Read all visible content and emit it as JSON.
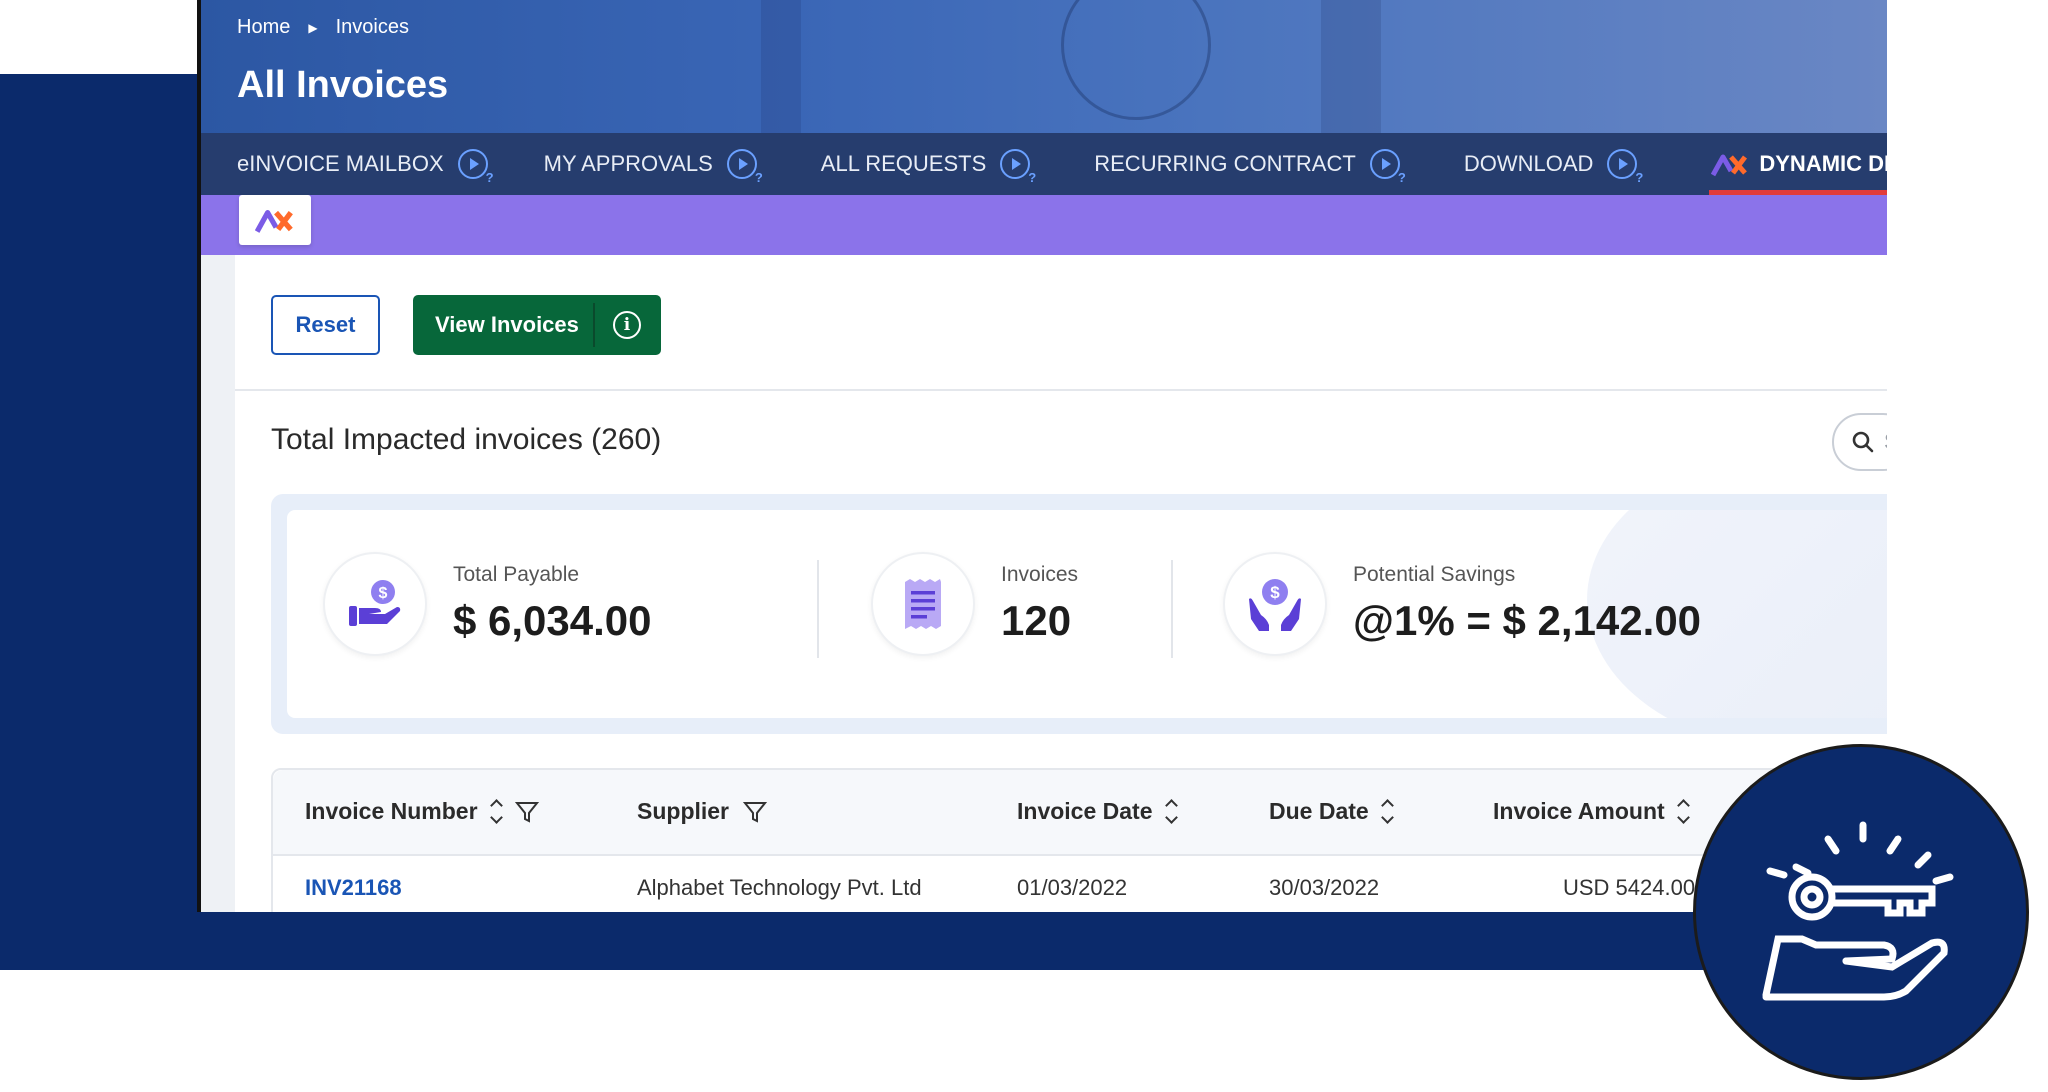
{
  "breadcrumb": {
    "home": "Home",
    "current": "Invoices"
  },
  "header": {
    "title": "All Invoices"
  },
  "tabs": [
    {
      "label": "eINVOICE MAILBOX"
    },
    {
      "label": "MY APPROVALS"
    },
    {
      "label": "ALL REQUESTS"
    },
    {
      "label": "RECURRING CONTRACT"
    },
    {
      "label": "DOWNLOAD"
    },
    {
      "label": "DYNAMIC DISC"
    }
  ],
  "actions": {
    "reset_label": "Reset",
    "view_label": "View Invoices",
    "info_glyph": "i"
  },
  "search": {
    "placeholder": "S"
  },
  "summary": {
    "title": "Total Impacted invoices (260)",
    "kpis": [
      {
        "label": "Total Payable",
        "value": "$ 6,034.00",
        "icon": "hand-dollar-icon"
      },
      {
        "label": "Invoices",
        "value": "120",
        "icon": "receipt-icon"
      },
      {
        "label": "Potential Savings",
        "value": "@1% = $ 2,142.00",
        "icon": "savings-hands-icon"
      }
    ]
  },
  "table": {
    "columns": [
      "Invoice Number",
      "Supplier",
      "Invoice Date",
      "Due Date",
      "Invoice Amount"
    ],
    "rows": [
      {
        "invoice_number": "INV21168",
        "supplier": "Alphabet Technology Pvt. Ltd",
        "invoice_date": "01/03/2022",
        "due_date": "30/03/2022",
        "amount": "USD 5424.00"
      }
    ]
  },
  "colors": {
    "navy": "#0b2a6b",
    "accent_purple": "#8b73ea",
    "primary_green": "#07673a",
    "link_blue": "#1a55b5",
    "tab_bg": "#263d6e"
  },
  "decor": {
    "badge_icon": "key-in-hand-icon"
  }
}
